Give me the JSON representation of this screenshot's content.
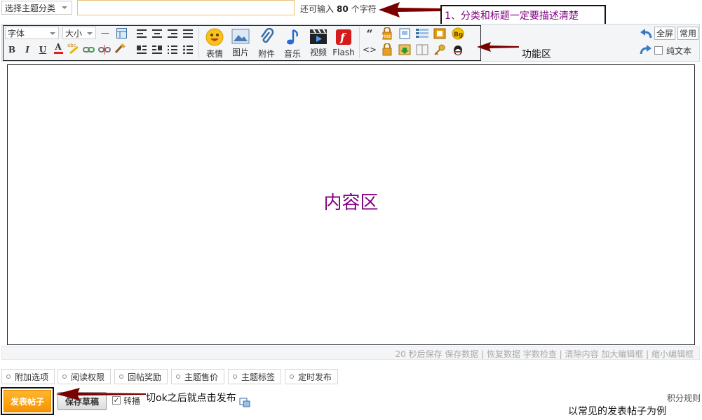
{
  "topbar": {
    "category_select": "选择主题分类",
    "title_value": "",
    "remaining_prefix": "还可输入",
    "remaining_count": "80",
    "remaining_suffix": "个字符"
  },
  "callouts": {
    "title_note": "1、分类和标题一定要描述清楚",
    "toolbar_note": "功能区",
    "content_note": "内容区",
    "publish_note": "切ok之后就点击发布",
    "footer_note": "以常见的发表帖子为例"
  },
  "toolbar": {
    "font_select": "字体",
    "size_select": "大小",
    "hr_glyph": "—",
    "bold": "B",
    "italic": "I",
    "underline": "U",
    "font_color": "A",
    "highlight_mark": "abc",
    "quote_glyph": "“",
    "code_glyph": "<>",
    "bg_badge": "Bg",
    "free_badge": "FREE",
    "emoji": "表情",
    "image": "图片",
    "attachment": "附件",
    "music": "音乐",
    "video": "视频",
    "flash": "Flash",
    "flash_glyph": "f",
    "fullscreen": "全屏",
    "common": "常用",
    "plaintext": "纯文本"
  },
  "editor": {
    "status_links": "20 秒后保存 保存数据 | 恢复数据    字数检查 | 清除内容    加大编辑框 | 缩小编辑框"
  },
  "options": {
    "tabs": [
      "附加选项",
      "阅读权限",
      "回帖奖励",
      "主题售价",
      "主题标签",
      "定时发布"
    ]
  },
  "actions": {
    "publish": "发表帖子",
    "save_draft": "保存草稿",
    "repost_checkbox": "转播",
    "checkbox_mark": "✓",
    "points_rules": "积分规则"
  },
  "colors": {
    "accent_orange": "#f79400",
    "annotation_purple": "#800080",
    "arrow_red": "#7a0000"
  }
}
